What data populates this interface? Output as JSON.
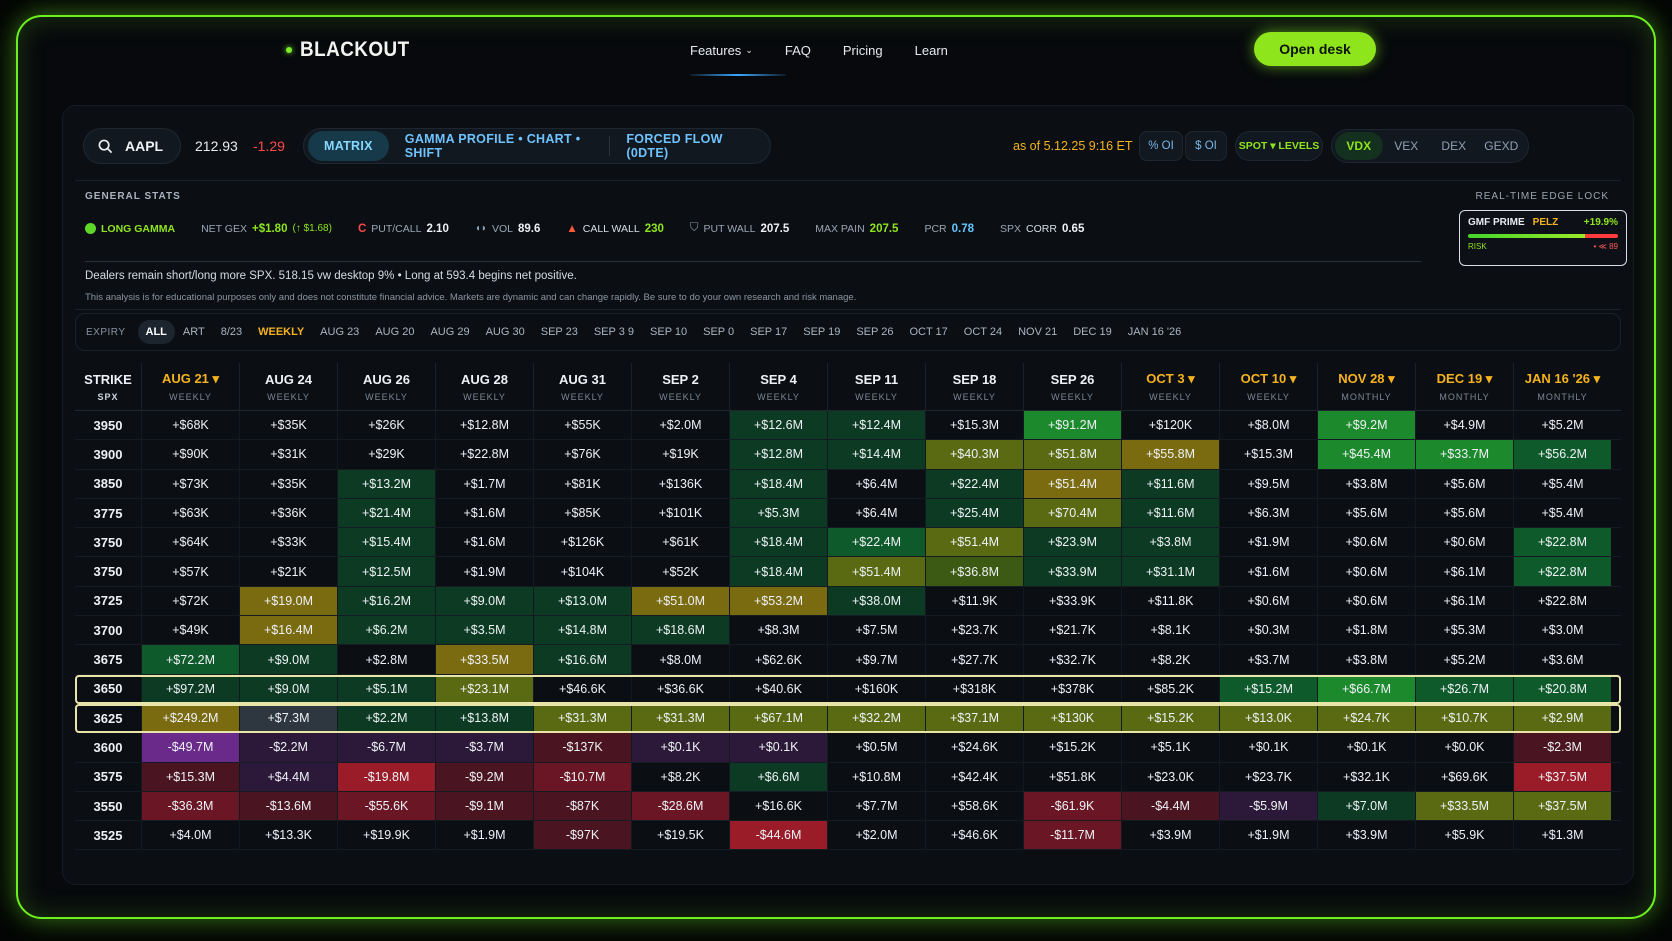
{
  "nav": {
    "brand": "BLACKOUT",
    "links": [
      "Features",
      "FAQ",
      "Pricing",
      "Learn"
    ],
    "cta": "Open desk"
  },
  "toolbar": {
    "ticker": "AAPL",
    "price": "212.93",
    "change": "-1.29",
    "modes": [
      "MATRIX",
      "GAMMA PROFILE • CHART • SHIFT",
      "FORCED FLOW (0DTE)"
    ],
    "asof": "as of 5.12.25 9:16 ET",
    "pct_oi": "% OI",
    "dollar_oi": "$ OI",
    "spot": "SPOT ▾ LEVELS",
    "metrics": [
      "VDX",
      "VEX",
      "DEX",
      "GEXD"
    ]
  },
  "stats": {
    "title": "GENERAL STATS",
    "edge_title": "REAL-TIME EDGE LOCK",
    "gamma": "LONG GAMMA",
    "net_gex_label": "NET GEX",
    "net_gex_value": "+$1.80",
    "net_gex_extra": "(↑ $1.68)",
    "putcall_label": "PUT/CALL",
    "putcall_value": "2.10",
    "vol_label": "VOL",
    "vol_value": "89.6",
    "callwall_label": "CALL WALL",
    "callwall_value": "230",
    "putwall_label": "PUT WALL",
    "putwall_value": "207.5",
    "maxpain_label": "MAX PAIN",
    "maxpain_value": "207.5",
    "pcr_label": "PCR",
    "pcr_value": "0.78",
    "spx_label": "SPX",
    "corr_label": "CORR",
    "corr_value": "0.65",
    "note": "Dealers remain short/long more SPX. 518.15 vw desktop 9% • Long at 593.4 begins net positive.",
    "disclaimer": "This analysis is for educational purposes only and does not constitute financial advice. Markets are dynamic and can change rapidly. Be sure to do your own research and risk manage."
  },
  "gmf": {
    "name": "GMF PRIME",
    "tag": "PELZ",
    "value": "+19.9%",
    "risk_label": "RISK",
    "risk_value": "• ≪ 89",
    "risk_level": 0.78
  },
  "expiry": {
    "label": "EXPIRY",
    "chips": [
      "ALL",
      "ART",
      "8/23",
      "WEEKLY",
      "AUG 23",
      "AUG 20",
      "AUG 29",
      "AUG 30",
      "SEP 23",
      "SEP 3 9",
      "SEP 10",
      "SEP 0",
      "SEP 17",
      "SEP 19",
      "SEP 26",
      "OCT 17",
      "OCT 24",
      "NOV 21",
      "DEC 19",
      "JAN 16 '26"
    ]
  },
  "grid": {
    "strike_label": "STRIKE",
    "strike_sub": "SPX",
    "columns": [
      {
        "date": "AUG 21 ▾",
        "type": "WEEKLY",
        "gold": true
      },
      {
        "date": "AUG 24",
        "type": "WEEKLY",
        "gold": false
      },
      {
        "date": "AUG 26",
        "type": "WEEKLY",
        "gold": false
      },
      {
        "date": "AUG 28",
        "type": "WEEKLY",
        "gold": false
      },
      {
        "date": "AUG 31",
        "type": "WEEKLY",
        "gold": false
      },
      {
        "date": "SEP 2",
        "type": "WEEKLY",
        "gold": false
      },
      {
        "date": "SEP 4",
        "type": "WEEKLY",
        "gold": false
      },
      {
        "date": "SEP 11",
        "type": "WEEKLY",
        "gold": false
      },
      {
        "date": "SEP 18",
        "type": "WEEKLY",
        "gold": false
      },
      {
        "date": "SEP 26",
        "type": "WEEKLY",
        "gold": false
      },
      {
        "date": "OCT 3 ▾",
        "type": "WEEKLY",
        "gold": true
      },
      {
        "date": "OCT 10 ▾",
        "type": "WEEKLY",
        "gold": true
      },
      {
        "date": "NOV 28 ▾",
        "type": "MONTHLY",
        "gold": true
      },
      {
        "date": "DEC 19 ▾",
        "type": "MONTHLY",
        "gold": true
      },
      {
        "date": "JAN 16 '26 ▾",
        "type": "MONTHLY",
        "gold": true
      }
    ],
    "rows": [
      {
        "strike": "3950",
        "hl": false,
        "cells": [
          "+$68K",
          "+$35K",
          "+$26K",
          "+$12.8M",
          "+$55K",
          "+$2.0M",
          "+$12.6M",
          "+$12.4M",
          "+$15.3M",
          "+$91.2M",
          "+$120K",
          "+$8.0M",
          "+$9.2M",
          "+$4.9M",
          "+$5.2M"
        ],
        "heat": [
          "n",
          "n",
          "n",
          "n",
          "n",
          "n",
          "g1",
          "g1",
          "n",
          "g3",
          "n",
          "n",
          "g3",
          "n",
          "n"
        ]
      },
      {
        "strike": "3900",
        "hl": false,
        "cells": [
          "+$90K",
          "+$31K",
          "+$29K",
          "+$22.8M",
          "+$76K",
          "+$19K",
          "+$12.8M",
          "+$14.4M",
          "+$40.3M",
          "+$51.8M",
          "+$55.8M",
          "+$15.3M",
          "+$45.4M",
          "+$33.7M",
          "+$56.2M"
        ],
        "heat": [
          "n",
          "n",
          "n",
          "n",
          "n",
          "n",
          "g1",
          "g1",
          "y2",
          "y2",
          "y3",
          "n",
          "g3",
          "g3",
          "g2"
        ]
      },
      {
        "strike": "3850",
        "hl": false,
        "cells": [
          "+$73K",
          "+$35K",
          "+$13.2M",
          "+$1.7M",
          "+$81K",
          "+$136K",
          "+$18.4M",
          "+$6.4M",
          "+$22.4M",
          "+$51.4M",
          "+$11.6M",
          "+$9.5M",
          "+$3.8M",
          "+$5.6M",
          "+$5.4M"
        ],
        "heat": [
          "n",
          "n",
          "g1",
          "n",
          "n",
          "n",
          "g1",
          "n",
          "g1",
          "y3",
          "g1",
          "n",
          "n",
          "n",
          "n"
        ]
      },
      {
        "strike": "3775",
        "hl": false,
        "cells": [
          "+$63K",
          "+$36K",
          "+$21.4M",
          "+$1.6M",
          "+$85K",
          "+$101K",
          "+$5.3M",
          "+$6.4M",
          "+$25.4M",
          "+$70.4M",
          "+$11.6M",
          "+$6.3M",
          "+$5.6M",
          "+$5.6M",
          "+$5.4M"
        ],
        "heat": [
          "n",
          "n",
          "g1",
          "n",
          "n",
          "n",
          "g1",
          "n",
          "g1",
          "y2",
          "g1",
          "n",
          "n",
          "n",
          "n"
        ]
      },
      {
        "strike": "3750",
        "hl": false,
        "cells": [
          "+$64K",
          "+$33K",
          "+$15.4M",
          "+$1.6M",
          "+$126K",
          "+$61K",
          "+$18.4M",
          "+$22.4M",
          "+$51.4M",
          "+$23.9M",
          "+$3.8M",
          "+$1.9M",
          "+$0.6M",
          "+$0.6M",
          "+$22.8M"
        ],
        "heat": [
          "n",
          "n",
          "g1",
          "n",
          "n",
          "n",
          "g1",
          "g2",
          "y2",
          "g1",
          "g1",
          "n",
          "n",
          "n",
          "g2"
        ]
      },
      {
        "strike": "3750",
        "hl": false,
        "cells": [
          "+$57K",
          "+$21K",
          "+$12.5M",
          "+$1.9M",
          "+$104K",
          "+$52K",
          "+$18.4M",
          "+$51.4M",
          "+$36.8M",
          "+$33.9M",
          "+$31.1M",
          "+$1.6M",
          "+$0.6M",
          "+$6.1M",
          "+$22.8M"
        ],
        "heat": [
          "n",
          "n",
          "g1",
          "n",
          "n",
          "n",
          "g1",
          "y2",
          "y1",
          "g1",
          "g1",
          "n",
          "n",
          "n",
          "g2"
        ]
      },
      {
        "strike": "3725",
        "hl": false,
        "cells": [
          "+$72K",
          "+$19.0M",
          "+$16.2M",
          "+$9.0M",
          "+$13.0M",
          "+$51.0M",
          "+$53.2M",
          "+$38.0M",
          "+$11.9K",
          "+$33.9K",
          "+$11.8K",
          "+$0.6M",
          "+$0.6M",
          "+$6.1M",
          "+$22.8M"
        ],
        "heat": [
          "n",
          "y3",
          "g1",
          "g1",
          "g1",
          "y3",
          "y3",
          "g1",
          "n",
          "n",
          "n",
          "n",
          "n",
          "n",
          "n"
        ]
      },
      {
        "strike": "3700",
        "hl": false,
        "cells": [
          "+$49K",
          "+$16.4M",
          "+$6.2M",
          "+$3.5M",
          "+$14.8M",
          "+$18.6M",
          "+$8.3M",
          "+$7.5M",
          "+$23.7K",
          "+$21.7K",
          "+$8.1K",
          "+$0.3M",
          "+$1.8M",
          "+$5.3M",
          "+$3.0M"
        ],
        "heat": [
          "n",
          "y3",
          "g1",
          "g1",
          "g1",
          "g1",
          "n",
          "n",
          "n",
          "n",
          "n",
          "n",
          "n",
          "n",
          "n"
        ]
      },
      {
        "strike": "3675",
        "hl": false,
        "cells": [
          "+$72.2M",
          "+$9.0M",
          "+$2.8M",
          "+$33.5M",
          "+$16.6M",
          "+$8.0M",
          "+$62.6K",
          "+$9.7M",
          "+$27.7K",
          "+$32.7K",
          "+$8.2K",
          "+$3.7M",
          "+$3.8M",
          "+$5.2M",
          "+$3.6M"
        ],
        "heat": [
          "g2",
          "g1",
          "n",
          "y3",
          "g1",
          "n",
          "n",
          "n",
          "n",
          "n",
          "n",
          "n",
          "n",
          "n",
          "n"
        ]
      },
      {
        "strike": "3650",
        "hl": true,
        "cells": [
          "+$97.2M",
          "+$9.0M",
          "+$5.1M",
          "+$23.1M",
          "+$46.6K",
          "+$36.6K",
          "+$40.6K",
          "+$160K",
          "+$318K",
          "+$378K",
          "+$85.2K",
          "+$15.2M",
          "+$66.7M",
          "+$26.7M",
          "+$20.8M"
        ],
        "heat": [
          "g1",
          "g1",
          "g1",
          "y2",
          "n",
          "n",
          "n",
          "n",
          "n",
          "n",
          "n",
          "g2",
          "g3",
          "g2",
          "g2"
        ]
      },
      {
        "strike": "3625",
        "hl": true,
        "cells": [
          "+$249.2M",
          "+$7.3M",
          "+$2.2M",
          "+$13.8M",
          "+$31.3M",
          "+$31.3M",
          "+$67.1M",
          "+$32.2M",
          "+$37.1M",
          "+$130K",
          "+$15.2K",
          "+$13.0K",
          "+$24.7K",
          "+$10.7K",
          "+$2.9M"
        ],
        "heat": [
          "y3",
          "s1",
          "g1",
          "g1",
          "y2",
          "y2",
          "y2",
          "y2",
          "y2",
          "y2",
          "y2",
          "y2",
          "y2",
          "y2",
          "y2"
        ]
      },
      {
        "strike": "3600",
        "hl": false,
        "cells": [
          "-$49.7M",
          "-$2.2M",
          "-$6.7M",
          "-$3.7M",
          "-$137K",
          "+$0.1K",
          "+$0.1K",
          "+$0.5M",
          "+$24.6K",
          "+$15.2K",
          "+$5.1K",
          "+$0.1K",
          "+$0.1K",
          "+$0.0K",
          "-$2.3M"
        ],
        "heat": [
          "p3",
          "p1",
          "p1",
          "p1",
          "r1",
          "p1",
          "p1",
          "n",
          "n",
          "n",
          "n",
          "n",
          "n",
          "n",
          "r1"
        ]
      },
      {
        "strike": "3575",
        "hl": false,
        "cells": [
          "+$15.3M",
          "+$4.4M",
          "-$19.8M",
          "-$9.2M",
          "-$10.7M",
          "+$8.2K",
          "+$6.6M",
          "+$10.8M",
          "+$42.4K",
          "+$51.8K",
          "+$23.0K",
          "+$23.7K",
          "+$32.1K",
          "+$69.6K",
          "+$37.5M"
        ],
        "heat": [
          "r1",
          "p1",
          "r3",
          "r1",
          "r2",
          "n",
          "g1",
          "n",
          "n",
          "n",
          "n",
          "n",
          "n",
          "n",
          "r3"
        ]
      },
      {
        "strike": "3550",
        "hl": false,
        "cells": [
          "-$36.3M",
          "-$13.6M",
          "-$55.6K",
          "-$9.1M",
          "-$87K",
          "-$28.6M",
          "+$16.6K",
          "+$7.7M",
          "+$58.6K",
          "-$61.9K",
          "-$4.4M",
          "-$5.9M",
          "+$7.0M",
          "+$33.5M",
          "+$37.5M"
        ],
        "heat": [
          "r2",
          "r1",
          "r2",
          "r1",
          "r1",
          "r2",
          "n",
          "n",
          "n",
          "r2",
          "r1",
          "p1",
          "g1",
          "y2",
          "y2"
        ]
      },
      {
        "strike": "3525",
        "hl": false,
        "cells": [
          "+$4.0M",
          "+$13.3K",
          "+$19.9K",
          "+$1.9M",
          "-$97K",
          "+$19.5K",
          "-$44.6M",
          "+$2.0M",
          "+$46.6K",
          "-$11.7M",
          "+$3.9M",
          "+$1.9M",
          "+$3.9M",
          "+$5.9K",
          "+$1.3M"
        ],
        "heat": [
          "n",
          "n",
          "n",
          "n",
          "r1",
          "n",
          "r3",
          "n",
          "n",
          "r2",
          "n",
          "n",
          "n",
          "n",
          "n"
        ]
      }
    ]
  },
  "colors": {
    "accent": "#8ee51c",
    "gold": "#f5b31e",
    "negative": "#ff4a4a",
    "link": "#66c7ff"
  }
}
